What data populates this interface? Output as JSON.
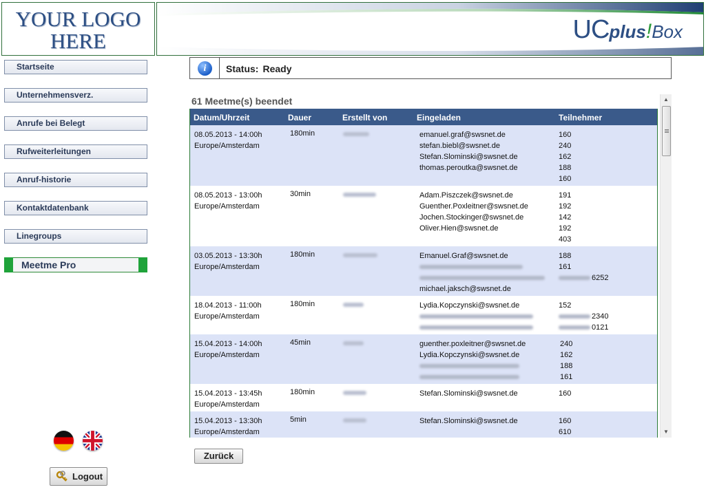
{
  "logo": {
    "line1": "YOUR LOGO",
    "line2": "HERE"
  },
  "brand": {
    "uc": "UC",
    "plus": "plus",
    "exclaim": "!",
    "box": "Box"
  },
  "sidebar": {
    "items": [
      {
        "label": "Startseite"
      },
      {
        "label": "Unternehmensverz."
      },
      {
        "label": "Anrufe bei Belegt"
      },
      {
        "label": "Rufweiterleitungen"
      },
      {
        "label": "Anruf-historie"
      },
      {
        "label": "Kontaktdatenbank"
      },
      {
        "label": "Linegroups"
      },
      {
        "label": "Meetme Pro",
        "active": true
      }
    ],
    "logout_label": "Logout"
  },
  "status": {
    "icon": "info-icon",
    "label": "Status:",
    "value": "Ready"
  },
  "list": {
    "title": "61 Meetme(s) beendet",
    "columns": [
      "Datum/Uhrzeit",
      "Dauer",
      "Erstellt von",
      "Eingeladen",
      "Teilnehmer"
    ],
    "rows": [
      {
        "datetime": "08.05.2013 - 14:00h",
        "timezone": "Europe/Amsterdam",
        "duration": "180min",
        "invitees": [
          "emanuel.graf@swsnet.de",
          "stefan.biebl@swsnet.de",
          "Stefan.Slominski@swsnet.de",
          "thomas.peroutka@swsnet.de",
          ""
        ],
        "participants": [
          "160",
          "240",
          "162",
          "188",
          "160"
        ]
      },
      {
        "datetime": "08.05.2013 - 13:00h",
        "timezone": "Europe/Amsterdam",
        "duration": "30min",
        "invitees": [
          "Adam.Piszczek@swsnet.de",
          "Guenther.Poxleitner@swsnet.de",
          "Jochen.Stockinger@swsnet.de",
          "Oliver.Hien@swsnet.de",
          ""
        ],
        "participants": [
          "191",
          "192",
          "142",
          "192",
          "403"
        ]
      },
      {
        "datetime": "03.05.2013 - 13:30h",
        "timezone": "Europe/Amsterdam",
        "duration": "180min",
        "invitees": [
          "Emanuel.Graf@swsnet.de",
          "",
          "",
          "michael.jaksch@swsnet.de"
        ],
        "participants": [
          "188",
          "161",
          "6252",
          ""
        ]
      },
      {
        "datetime": "18.04.2013 - 11:00h",
        "timezone": "Europe/Amsterdam",
        "duration": "180min",
        "invitees": [
          "Lydia.Kopczynski@swsnet.de",
          "",
          ""
        ],
        "participants": [
          "152",
          "2340",
          "0121"
        ]
      },
      {
        "datetime": "15.04.2013 - 14:00h",
        "timezone": "Europe/Amsterdam",
        "duration": "45min",
        "invitees": [
          "guenther.poxleitner@swsnet.de",
          "Lydia.Kopczynski@swsnet.de",
          "",
          ""
        ],
        "participants": [
          "240",
          "162",
          "188",
          "161"
        ]
      },
      {
        "datetime": "15.04.2013 - 13:45h",
        "timezone": "Europe/Amsterdam",
        "duration": "180min",
        "invitees": [
          "Stefan.Slominski@swsnet.de"
        ],
        "participants": [
          "160"
        ]
      },
      {
        "datetime": "15.04.2013 - 13:30h",
        "timezone": "Europe/Amsterdam",
        "duration": "5min",
        "invitees": [
          "Stefan.Slominski@swsnet.de"
        ],
        "participants": [
          "160",
          "610"
        ]
      }
    ]
  },
  "back_label": "Zurück",
  "colors": {
    "header": "#3a5a8a",
    "odd_row": "#dce3f7",
    "accent_green": "#1fa33a",
    "brand_blue": "#2d4f84"
  }
}
